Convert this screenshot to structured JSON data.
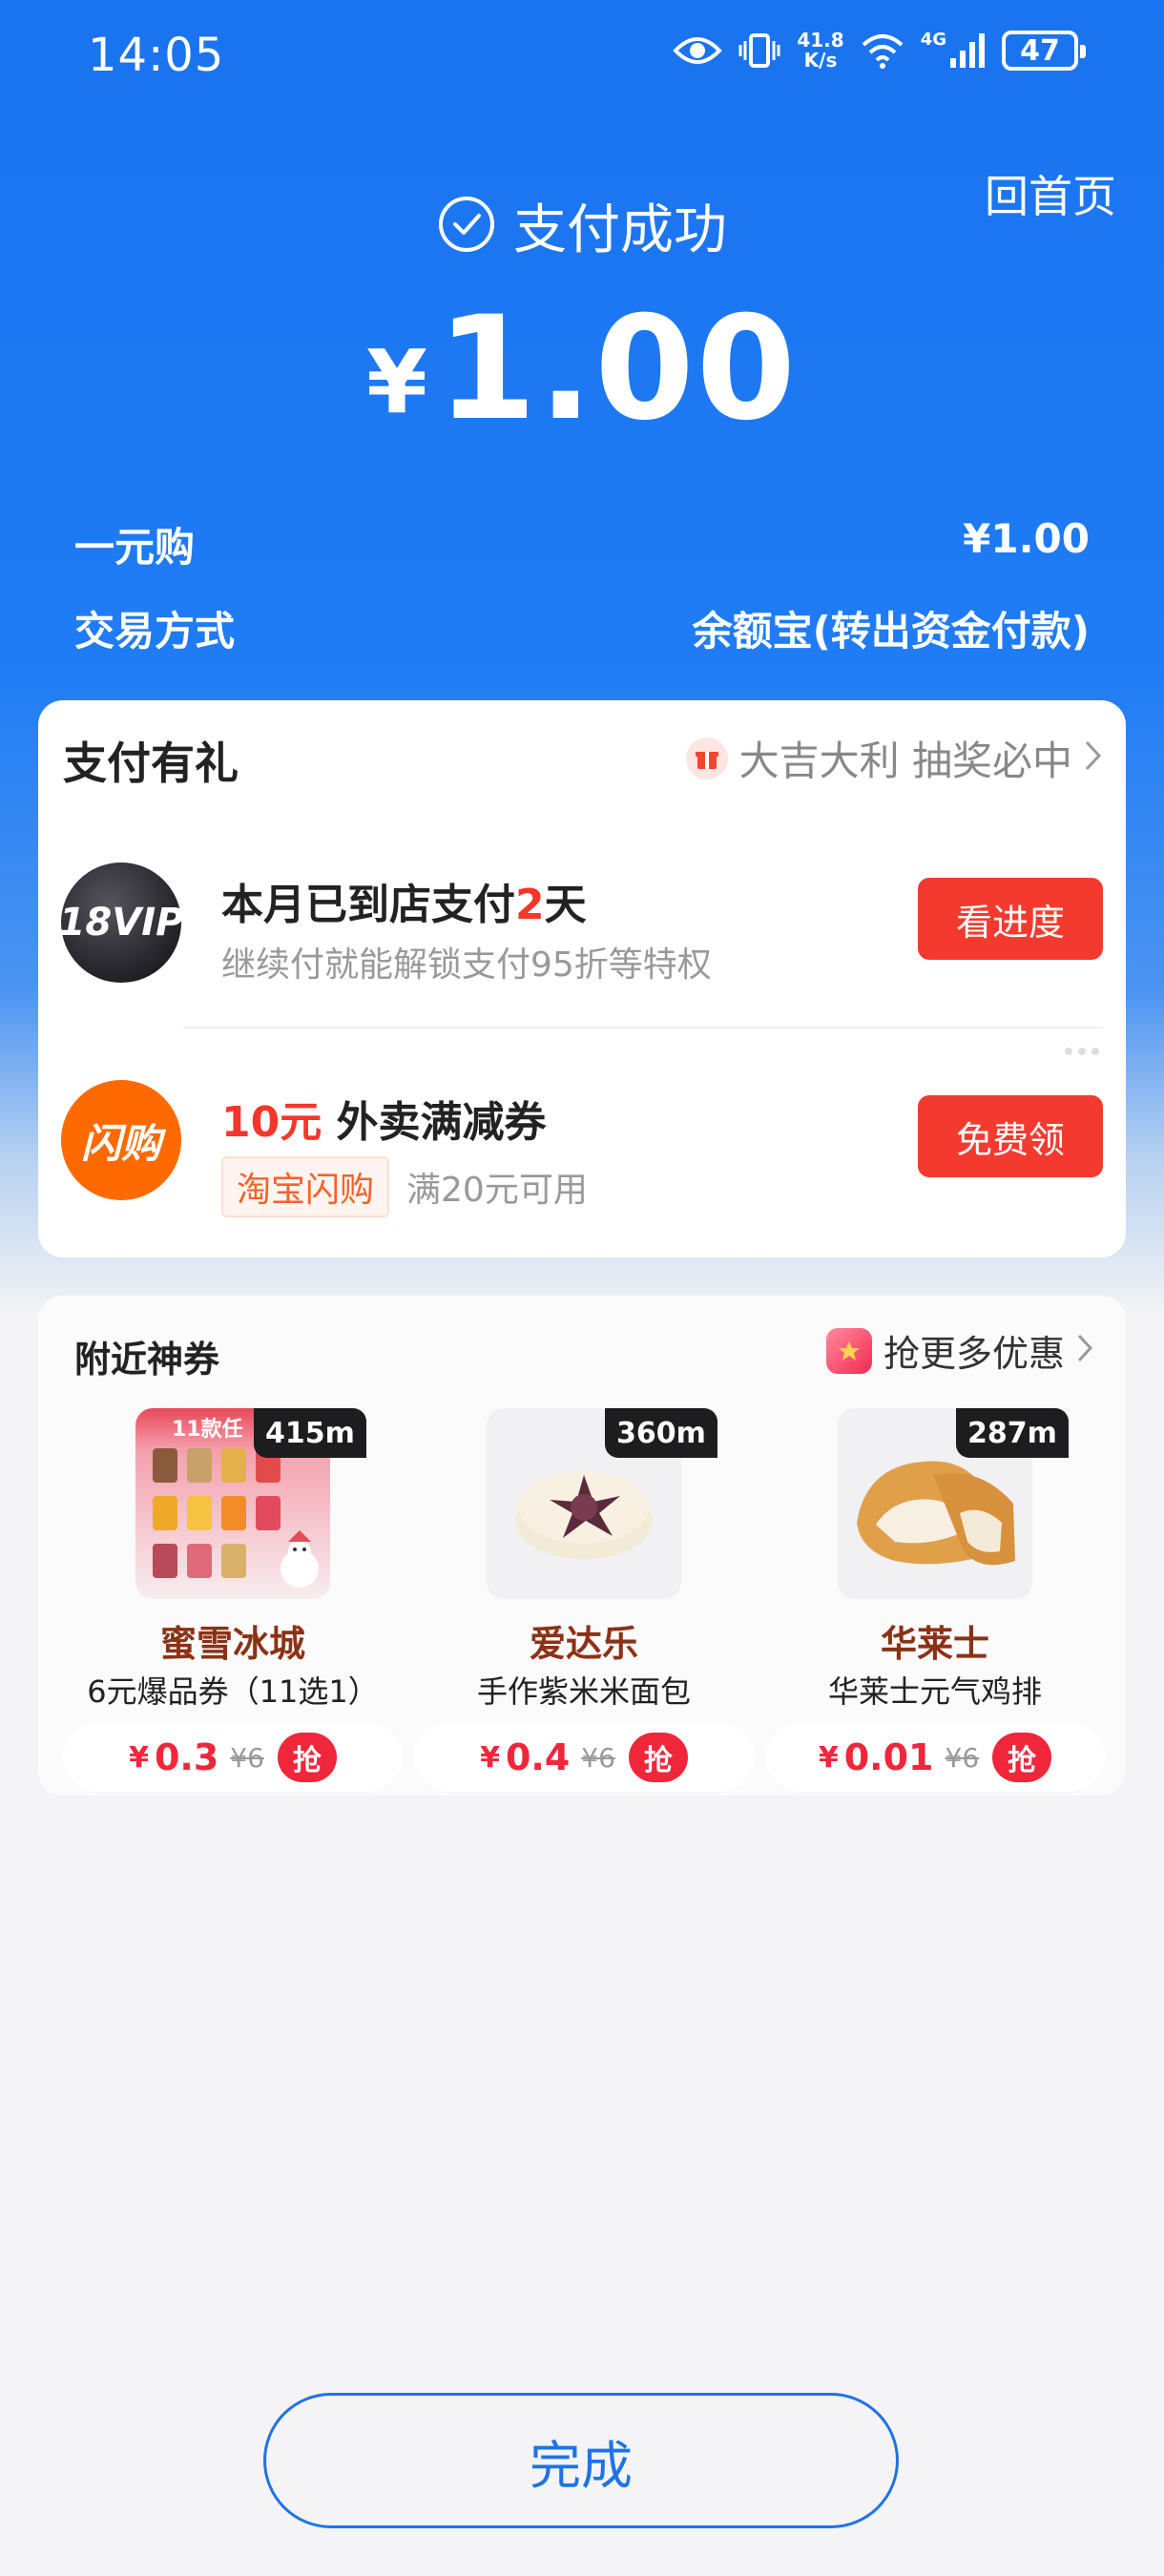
{
  "status_bar": {
    "time": "14:05",
    "net_speed_value": "41.8",
    "net_speed_unit": "K/s",
    "network": "4G",
    "battery": "47"
  },
  "header": {
    "home_label": "回首页",
    "success_text": "支付成功",
    "currency": "¥",
    "amount": "1.00"
  },
  "details": [
    {
      "label": "一元购",
      "value": "¥1.00"
    },
    {
      "label": "交易方式",
      "value": "余额宝(转出资金付款)"
    }
  ],
  "gift_section": {
    "title": "支付有礼",
    "lottery_text": "大吉大利 抽奖必中",
    "items": [
      {
        "badge": "18VIP",
        "title_prefix": "本月已到店支付",
        "title_highlight": "2",
        "title_suffix": "天",
        "subtitle": "继续付就能解锁支付95折等特权",
        "button": "看进度"
      },
      {
        "badge": "闪购",
        "title_highlight": "10元",
        "title_suffix": " 外卖满减券",
        "tag": "淘宝闪购",
        "subtitle": "满20元可用",
        "button": "免费领"
      }
    ]
  },
  "nearby": {
    "title": "附近神券",
    "more_label": "抢更多优惠",
    "deals": [
      {
        "distance": "415m",
        "shop": "蜜雪冰城",
        "product": "6元爆品券（11选1）",
        "yen": "¥",
        "price": "0.3",
        "original": "¥6",
        "grab": "抢",
        "banner": "11款任"
      },
      {
        "distance": "360m",
        "shop": "爱达乐",
        "product": "手作紫米米面包",
        "yen": "¥",
        "price": "0.4",
        "original": "¥6",
        "grab": "抢"
      },
      {
        "distance": "287m",
        "shop": "华莱士",
        "product": "华莱士元气鸡排",
        "yen": "¥",
        "price": "0.01",
        "original": "¥6",
        "grab": "抢"
      }
    ]
  },
  "footer": {
    "done_label": "完成"
  },
  "colors": {
    "primary_blue": "#1a73f0",
    "accent_red": "#f43a2f",
    "flash_orange": "#ff6a00",
    "shop_brown": "#8b3216"
  }
}
